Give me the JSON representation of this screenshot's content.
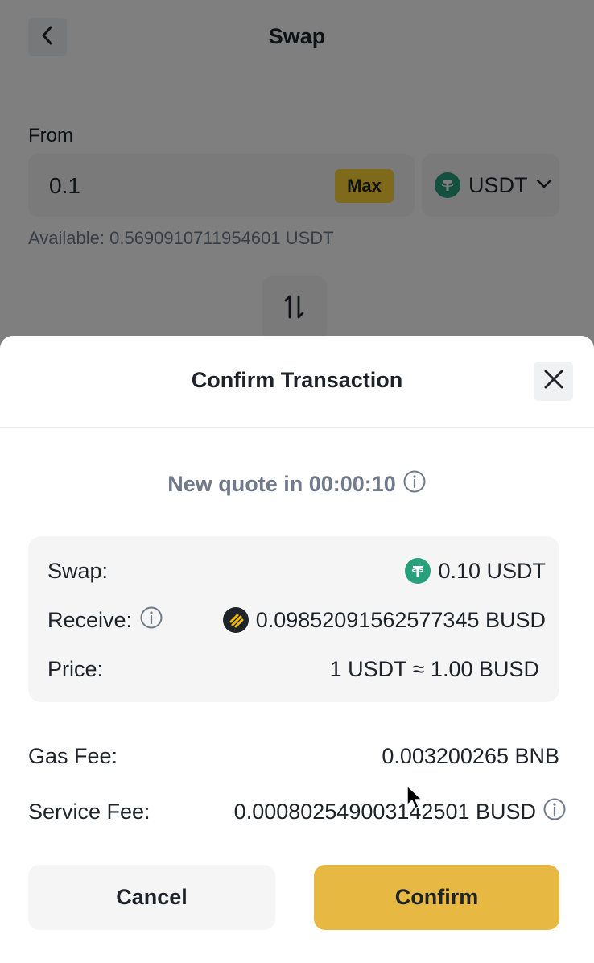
{
  "colors": {
    "accent": "#e7b942",
    "max_badge": "#fcd535",
    "usdt": "#26a17b",
    "busd_bg": "#1e2329",
    "busd_mark": "#f0b90b",
    "muted": "#707a8a"
  },
  "header": {
    "back_icon": "chevron-left-icon",
    "title": "Swap"
  },
  "from": {
    "label": "From",
    "amount": "0.1",
    "max_label": "Max",
    "token": "USDT",
    "token_icon": "usdt-icon",
    "dropdown_icon": "chevron-down-icon",
    "available": "Available: 0.5690910711954601 USDT"
  },
  "flip_icon": "swap-arrows-icon",
  "dialog": {
    "title": "Confirm Transaction",
    "close_icon": "close-icon",
    "quote": "New quote in 00:00:10",
    "info_icon": "info-icon",
    "summary": {
      "swap_label": "Swap:",
      "swap_value": "0.10 USDT",
      "receive_label": "Receive:",
      "receive_value": "0.09852091562577345 BUSD",
      "price_label": "Price:",
      "price_value": "1 USDT ≈ 1.00 BUSD"
    },
    "gas_fee_label": "Gas Fee:",
    "gas_fee_value": "0.003200265 BNB",
    "service_fee_label": "Service Fee:",
    "service_fee_value": "0.000802549003142501 BUSD",
    "cancel_label": "Cancel",
    "confirm_label": "Confirm"
  }
}
